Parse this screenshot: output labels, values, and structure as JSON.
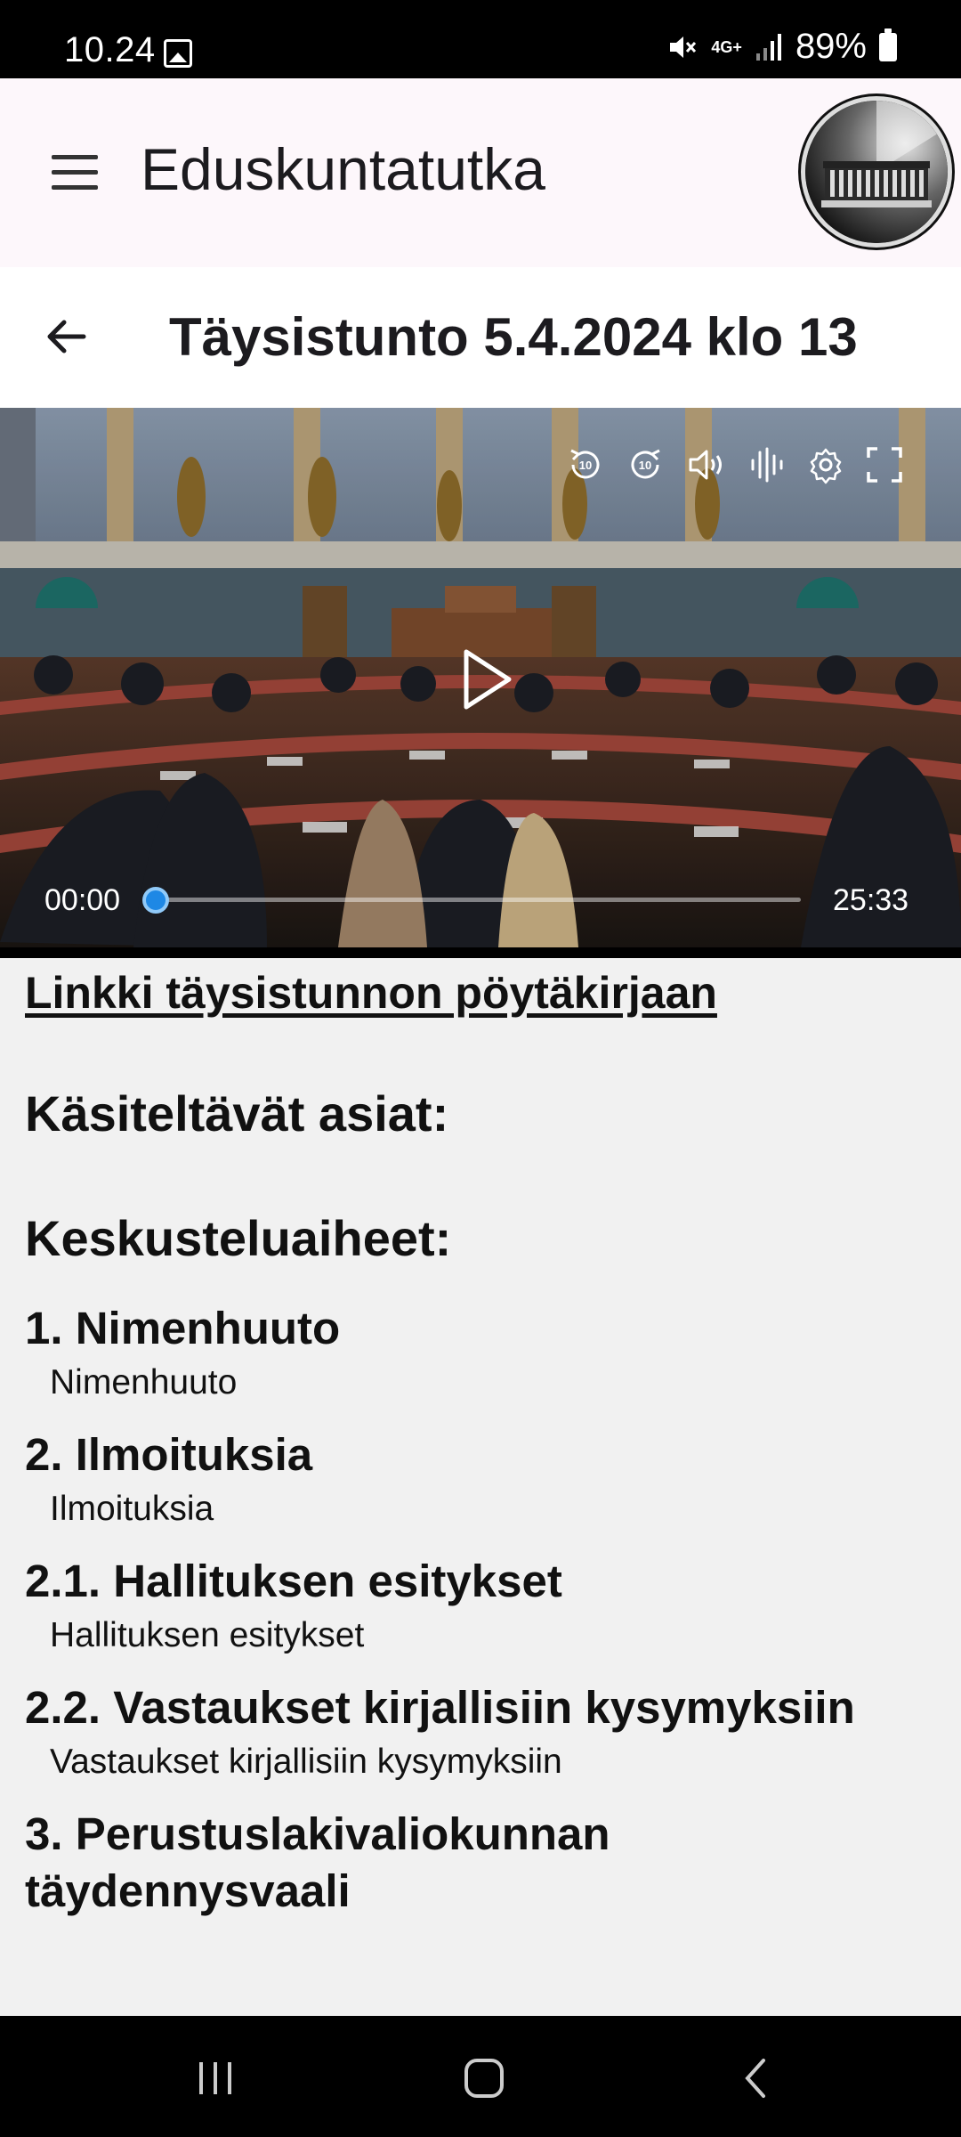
{
  "status_bar": {
    "time": "10.24",
    "network": "4G+",
    "battery": "89%"
  },
  "app_bar": {
    "title": "Eduskuntatutka"
  },
  "session": {
    "title": "Täysistunto 5.4.2024 klo 13"
  },
  "video": {
    "current_time": "00:00",
    "duration": "25:33",
    "progress": 0
  },
  "content": {
    "minutes_link": "Linkki täysistunnon pöytäkirjaan",
    "items_heading": "Käsiteltävät asiat:",
    "topics_heading": "Keskusteluaiheet:",
    "agenda": [
      {
        "title": "1. Nimenhuuto",
        "subtitle": "Nimenhuuto"
      },
      {
        "title": "2. Ilmoituksia",
        "subtitle": "Ilmoituksia"
      },
      {
        "title": "2.1. Hallituksen esitykset",
        "subtitle": "Hallituksen esitykset"
      },
      {
        "title": "2.2. Vastaukset kirjallisiin kysymyksiin",
        "subtitle": "Vastaukset kirjallisiin kysymyksiin"
      },
      {
        "title": "3. Perustuslakivaliokunnan täydennysvaali",
        "subtitle": ""
      }
    ]
  }
}
